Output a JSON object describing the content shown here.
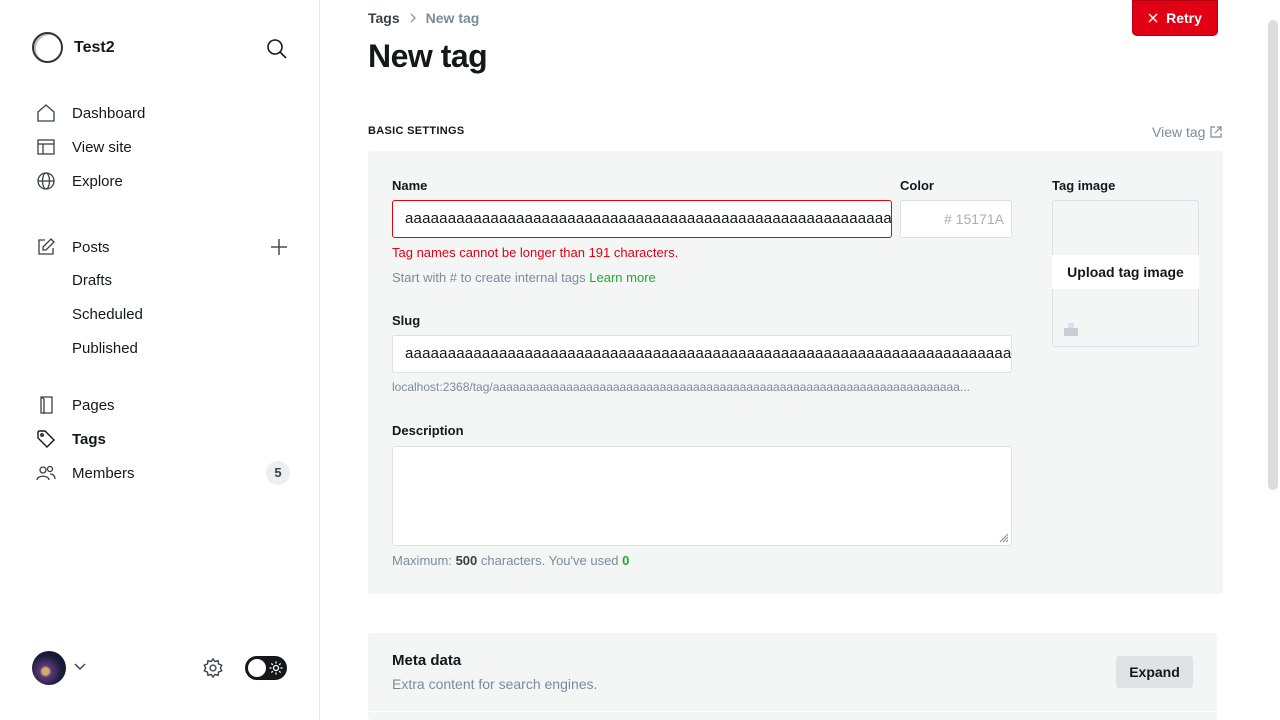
{
  "app": {
    "site_name": "Test2"
  },
  "sidebar": {
    "primary": [
      {
        "label": "Dashboard",
        "icon": "home-icon"
      },
      {
        "label": "View site",
        "icon": "layout-icon"
      },
      {
        "label": "Explore",
        "icon": "globe-icon"
      }
    ],
    "posts": {
      "label": "Posts",
      "icon": "edit-icon"
    },
    "post_subitems": [
      "Drafts",
      "Scheduled",
      "Published"
    ],
    "secondary": [
      {
        "label": "Pages",
        "icon": "page-icon"
      },
      {
        "label": "Tags",
        "icon": "tag-icon",
        "active": true
      },
      {
        "label": "Members",
        "icon": "members-icon"
      }
    ],
    "members_count": "5"
  },
  "header": {
    "breadcrumb_parent": "Tags",
    "breadcrumb_current": "New tag",
    "title": "New tag",
    "retry_label": "Retry"
  },
  "basic_settings": {
    "section_title": "BASIC SETTINGS",
    "view_tag_label": "View tag",
    "name_label": "Name",
    "name_value": "aaaaaaaaaaaaaaaaaaaaaaaaaaaaaaaaaaaaaaaaaaaaaaaaaaaaaaaaaaaaaaaaaaaaaaaaaaaaaaaaaaaaaaaaaaaaaaaaaaaaaaaaaaaaaaaaaaaaaaaaaaaaaaaaaaaaaaaaaaaaaaaaaaaaaaaaaaaaaaaaaaaaaaaaaaaaaaaaaaaaaaaaaaaaaaaaaaaaaaaaaaaaaaaaa",
    "name_error": "Tag names cannot be longer than 191 characters.",
    "name_hint": "Start with # to create internal tags",
    "learn_more": "Learn more",
    "color_label": "Color",
    "color_value": "# 15171A",
    "tag_image_label": "Tag image",
    "upload_label": "Upload tag image",
    "slug_label": "Slug",
    "slug_value": "aaaaaaaaaaaaaaaaaaaaaaaaaaaaaaaaaaaaaaaaaaaaaaaaaaaaaaaaaaaaaaaaaaaaaaaaaaaaaaaaaaaaaaaaaaaaaaaaaaaaaaaaaaaaaaaaaaaaaaaaaaaaaaaaaaaaaaaaaaaaaaaaaaaaaaaaaaaaaaaaaaaaaaaaaaaaaaaaaaaaaaaaaaaaaa",
    "slug_url": "localhost:2368/tag/aaaaaaaaaaaaaaaaaaaaaaaaaaaaaaaaaaaaaaaaaaaaaaaaaaaaaaaaaaaaaaaaaaaaaa...",
    "description_label": "Description",
    "description_value": "",
    "counter_prefix": "Maximum:",
    "counter_max": "500",
    "counter_mid": "characters. You've used",
    "counter_used": "0"
  },
  "meta_data": {
    "title": "Meta data",
    "subtitle": "Extra content for search engines.",
    "expand_label": "Expand"
  },
  "colors": {
    "accent_error": "#e10014",
    "accent_green": "#1fa832",
    "panel_bg": "#f4f5f5"
  }
}
